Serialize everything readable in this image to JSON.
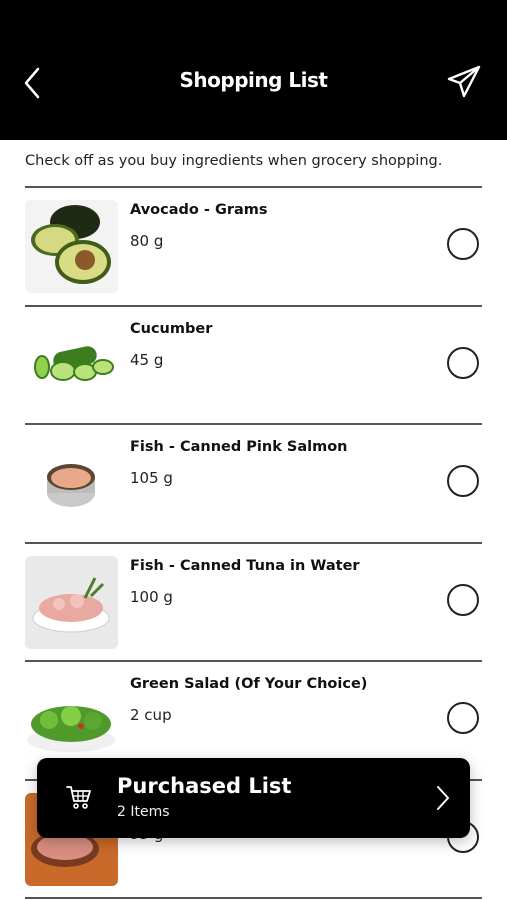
{
  "header": {
    "title": "Shopping List"
  },
  "subtitle": "Check off as you buy ingredients when grocery shopping.",
  "items": [
    {
      "name": "Avocado - Grams",
      "qty": "80 g"
    },
    {
      "name": "Cucumber",
      "qty": "45 g"
    },
    {
      "name": "Fish - Canned Pink Salmon",
      "qty": "105 g"
    },
    {
      "name": "Fish - Canned Tuna in Water",
      "qty": "100 g"
    },
    {
      "name": "Green Salad (Of Your Choice)",
      "qty": "2 cup"
    },
    {
      "name": "",
      "qty": "95 g"
    }
  ],
  "purchased": {
    "title": "Purchased List",
    "count": "2 Items"
  },
  "icons": {
    "back": "chevron-left-icon",
    "send": "paper-plane-icon",
    "cart": "shopping-cart-icon",
    "next": "chevron-right-icon"
  },
  "colors": {
    "header_bg": "#000000",
    "divider": "#555555",
    "card_bg": "#000000"
  }
}
